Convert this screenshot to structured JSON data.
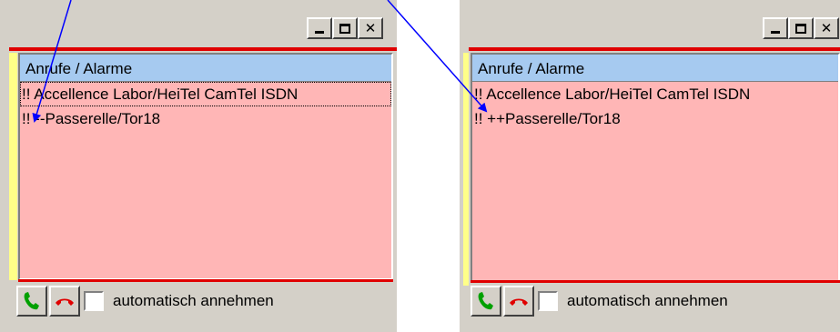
{
  "left": {
    "list_header": "Anrufe / Alarme",
    "items": [
      "!! Accellence Labor/HeiTel CamTel ISDN",
      "!! --Passerelle/Tor18"
    ],
    "checkbox_label": "automatisch annehmen",
    "checkbox_checked": false
  },
  "right": {
    "list_header": "Anrufe / Alarme",
    "items": [
      "!! Accellence Labor/HeiTel CamTel ISDN",
      "!! ++Passerelle/Tor18"
    ],
    "checkbox_label": "automatisch annehmen",
    "checkbox_checked": false
  },
  "window_buttons": [
    "minimize",
    "maximize",
    "close"
  ],
  "icons": {
    "accept_call": "phone-accept-icon",
    "hangup_call": "phone-hangup-icon"
  },
  "colors": {
    "list_background": "#ffb6b6",
    "header_background": "#a6caf0",
    "frame_red": "#e00000",
    "accept_green": "#00a000",
    "hangup_red": "#e00000",
    "arrow_blue": "#0000ff"
  }
}
